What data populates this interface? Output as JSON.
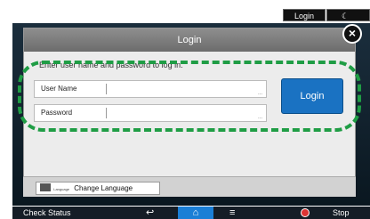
{
  "topbar": {
    "login_label": "Login",
    "moon_label": "☾"
  },
  "dialog": {
    "title": "Login",
    "instruction": "Enter user name and password to log in.",
    "user_label": "User Name",
    "password_label": "Password",
    "login_button": "Login",
    "close_glyph": "×"
  },
  "language": {
    "small_label": "Language",
    "button_label": "Change Language"
  },
  "bottom": {
    "check_status": "Check Status",
    "back_glyph": "↩",
    "home_glyph": "⌂",
    "menu_glyph": "≡",
    "stop_label": "Stop"
  },
  "colors": {
    "accent": "#1a72c2",
    "highlight": "#1f9d45",
    "home_active": "#1b7fd6"
  }
}
